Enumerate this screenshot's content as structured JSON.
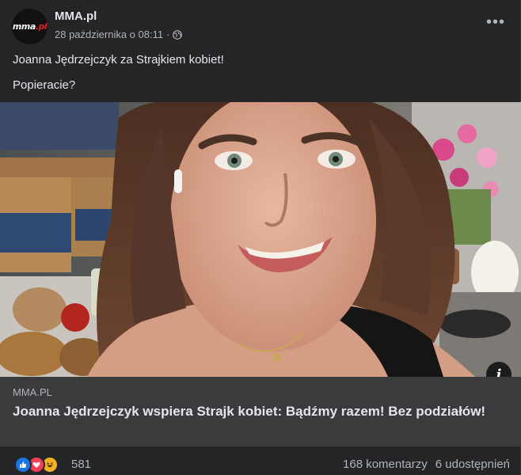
{
  "post": {
    "page_name": "MMA.pl",
    "avatar_logo": {
      "prefix": "mma",
      "suffix": ".pl"
    },
    "timestamp": "28 października o 08:11",
    "separator": "·",
    "text_lines": [
      "Joanna Jędrzejczyk za Strajkiem kobiet!",
      "Popieracie?"
    ],
    "more_label": "•••"
  },
  "link_card": {
    "domain": "MMA.PL",
    "title": "Joanna Jędrzejczyk wspiera Strajk kobiet: Bądźmy razem! Bez podziałów!",
    "info_label": "i"
  },
  "footer": {
    "reaction_icons": [
      "like-icon",
      "love-icon",
      "haha-icon"
    ],
    "reaction_count": "581",
    "comments": "168 komentarzy",
    "shares": "6 udostępnień"
  },
  "colors": {
    "background": "#242526",
    "card": "#3a3b3c",
    "primary_text": "#e4e6eb",
    "secondary_text": "#b0b3b8",
    "like": "#1b74e4",
    "love": "#f33e58",
    "haha": "#f7b125"
  }
}
